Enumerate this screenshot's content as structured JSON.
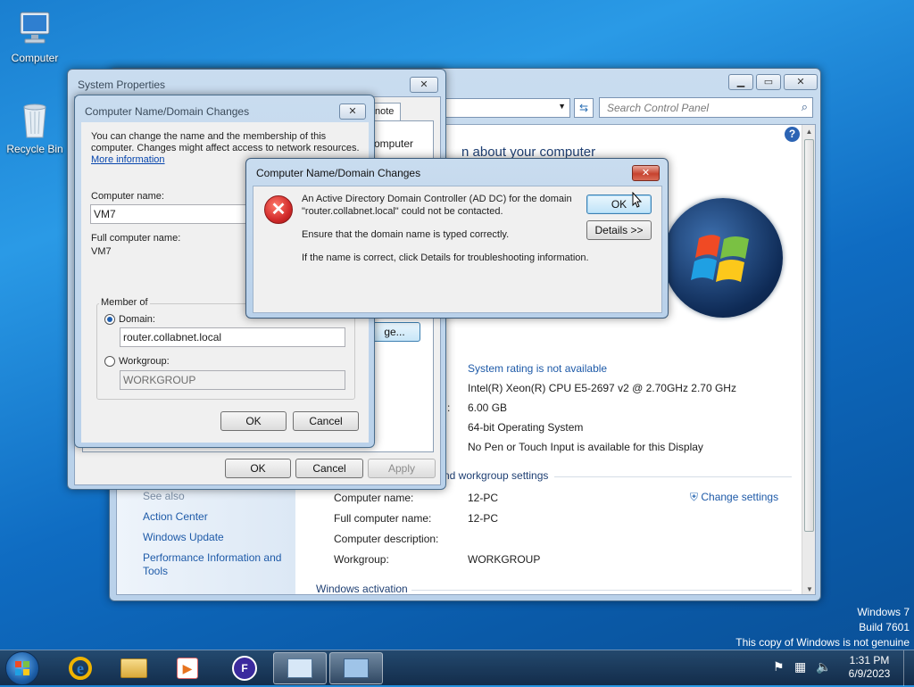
{
  "desktop": {
    "icons": [
      {
        "label": "Computer"
      },
      {
        "label": "Recycle Bin"
      }
    ],
    "watermark": {
      "line1": "Windows 7",
      "line2": "Build 7601",
      "line3": "This copy of Windows is not genuine"
    }
  },
  "control_panel": {
    "search_placeholder": "Search Control Panel",
    "heading_partial": "n about your computer",
    "rating": "System rating is not available",
    "processor": "Intel(R) Xeon(R) CPU E5-2697 v2 @ 2.70GHz   2.70 GHz",
    "memory_colon": ":",
    "memory": "6.00 GB",
    "system_type": "64-bit Operating System",
    "pen_touch": "No Pen or Touch Input is available for this Display",
    "section_cn": "nd workgroup settings",
    "change_settings": "Change settings",
    "rows": [
      {
        "label": "Computer name:",
        "value": "12-PC"
      },
      {
        "label": "Full computer name:",
        "value": "12-PC"
      },
      {
        "label": "Computer description:",
        "value": ""
      },
      {
        "label": "Workgroup:",
        "value": "WORKGROUP"
      }
    ],
    "section_activation": "Windows activation",
    "see_also": "See also",
    "see_also_links": [
      "Action Center",
      "Windows Update",
      "Performance Information and",
      "Tools"
    ]
  },
  "system_properties": {
    "title": "System Properties",
    "tab_partial": "note",
    "text_partial": "omputer",
    "change_button_partial": "ge...",
    "ok": "OK",
    "cancel": "Cancel",
    "apply": "Apply"
  },
  "name_changes": {
    "title": "Computer Name/Domain Changes",
    "intro_line1": "You can change the name and the membership of this",
    "intro_line2": "computer. Changes might affect access to network resources.",
    "more_info": "More information",
    "computer_name_label": "Computer name:",
    "computer_name_value": "VM7",
    "full_name_label": "Full computer name:",
    "full_name_value": "VM7",
    "member_of": "Member of",
    "domain_label": "Domain:",
    "domain_value": "router.collabnet.local",
    "workgroup_label": "Workgroup:",
    "workgroup_value": "WORKGROUP",
    "ok": "OK",
    "cancel": "Cancel"
  },
  "error_dialog": {
    "title": "Computer Name/Domain Changes",
    "line1": "An Active Directory Domain Controller (AD DC) for the domain",
    "line2": "\"router.collabnet.local\" could not be contacted.",
    "line3": "Ensure that the domain name is typed correctly.",
    "line4": "If the name is correct, click Details for troubleshooting information.",
    "ok": "OK",
    "details": "Details >>"
  },
  "taskbar": {
    "time": "1:31 PM",
    "date": "6/9/2023"
  },
  "colors": {
    "accent": "#1e5aa8",
    "error_red": "#d22b2b"
  }
}
